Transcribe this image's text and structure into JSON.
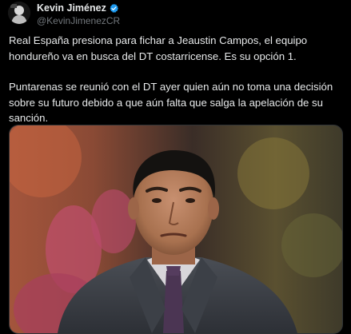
{
  "author": {
    "display_name": "Kevin Jiménez",
    "handle": "@KevinJimenezCR",
    "avatar_icon": "profile-photo",
    "verified_icon": "verified-badge-icon",
    "verified_color": "#1d9bf0"
  },
  "tweet": {
    "paragraphs": [
      "Real España presiona para fichar a Jeaustin Campos, el equipo hondureño va en busca del DT costarricense. Es su opción 1.",
      "Puntarenas se reunió con el DT ayer quien aún no toma una decisión sobre su futuro debido a que aún falta que salga la apelación de su sanción."
    ]
  },
  "media": {
    "kind": "photo",
    "subject": "coach-portrait"
  },
  "colors": {
    "background": "#000000",
    "text": "#e7e9ea",
    "secondary_text": "#71767b",
    "accent": "#1d9bf0"
  }
}
